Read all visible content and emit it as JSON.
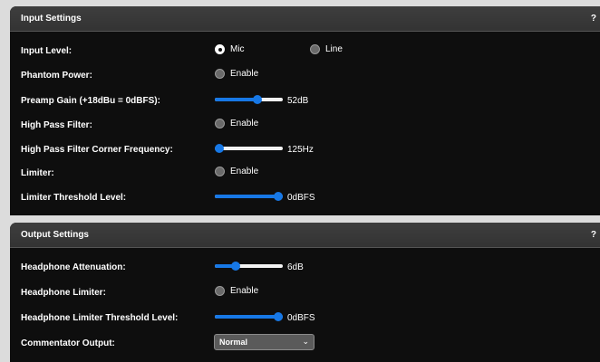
{
  "input_settings": {
    "title": "Input Settings",
    "help": "?",
    "input_level": {
      "label": "Input Level:",
      "options": [
        "Mic",
        "Line"
      ],
      "selected": "Mic"
    },
    "phantom_power": {
      "label": "Phantom Power:",
      "option": "Enable",
      "checked": false
    },
    "preamp_gain": {
      "label": "Preamp Gain (+18dBu = 0dBFS):",
      "value": "52dB",
      "level": 0.62
    },
    "high_pass_filter": {
      "label": "High Pass Filter:",
      "option": "Enable",
      "checked": false
    },
    "hpf_corner_frequency": {
      "label": "High Pass Filter Corner Frequency:",
      "value": "125Hz",
      "level": 0.06
    },
    "limiter": {
      "label": "Limiter:",
      "option": "Enable",
      "checked": false
    },
    "limiter_threshold": {
      "label": "Limiter Threshold Level:",
      "value": "0dBFS",
      "level": 1.0
    }
  },
  "output_settings": {
    "title": "Output Settings",
    "help": "?",
    "headphone_attenuation": {
      "label": "Headphone Attenuation:",
      "value": "6dB",
      "level": 0.3
    },
    "headphone_limiter": {
      "label": "Headphone Limiter:",
      "option": "Enable",
      "checked": false
    },
    "headphone_limiter_threshold": {
      "label": "Headphone Limiter Threshold Level:",
      "value": "0dBFS",
      "level": 1.0
    },
    "commentator_output": {
      "label": "Commentator Output:",
      "selected": "Normal"
    }
  },
  "icons": {
    "dropdown": "chevron-down-icon"
  },
  "colors": {
    "accent": "#1778e6",
    "panel_bg": "#0e0e0e",
    "header_bg": "#3a3a3a"
  }
}
